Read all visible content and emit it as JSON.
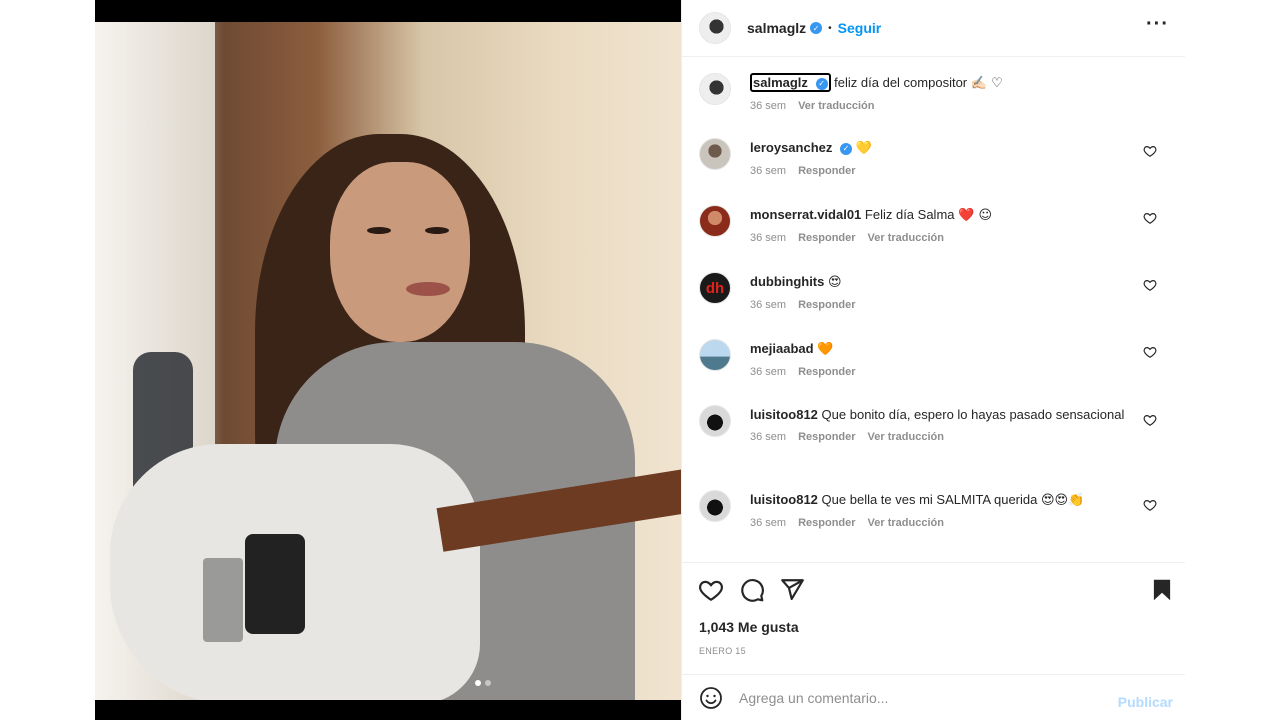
{
  "post": {
    "author": "salmaglz",
    "follow_label": "Seguir",
    "separator": "•",
    "more_label": "···",
    "next_label": "›"
  },
  "caption": {
    "user": "salmaglz",
    "text": "feliz día del compositor",
    "emoji": "✍🏻 ♡",
    "time": "36 sem",
    "translate": "Ver traducción"
  },
  "comments": [
    {
      "user": "leroysanchez",
      "verified": true,
      "text": "",
      "emoji": "💛",
      "time": "36 sem",
      "reply": "Responder",
      "translate": ""
    },
    {
      "user": "monserrat.vidal01",
      "verified": false,
      "text": "Feliz día Salma",
      "emoji": "❤️ ☺",
      "time": "36 sem",
      "reply": "Responder",
      "translate": "Ver traducción"
    },
    {
      "user": "dubbinghits",
      "verified": false,
      "text": "",
      "emoji": "😍",
      "time": "36 sem",
      "reply": "Responder",
      "translate": ""
    },
    {
      "user": "mejiaabad",
      "verified": false,
      "text": "",
      "emoji": "🧡",
      "time": "36 sem",
      "reply": "Responder",
      "translate": ""
    },
    {
      "user": "luisitoo812",
      "verified": false,
      "text": "Que bonito día, espero lo hayas pasado sensacional",
      "emoji": "",
      "time": "36 sem",
      "reply": "Responder",
      "translate": "Ver traducción"
    },
    {
      "user": "luisitoo812",
      "verified": false,
      "text": "Que bella te ves mi SALMITA querida",
      "emoji": "😍😍👏",
      "time": "36 sem",
      "reply": "Responder",
      "translate": "Ver traducción"
    }
  ],
  "avatars": {
    "dubbinghits": "dh"
  },
  "stats": {
    "likes": "1,043 Me gusta",
    "date": "ENERO 15"
  },
  "comment_box": {
    "placeholder": "Agrega un comentario...",
    "publish_label": "Publicar",
    "emoji_icon": "smiley-icon"
  },
  "colors": {
    "accent": "#0095f6",
    "verified": "#3897f0",
    "muted": "#8e8e8e",
    "publish_disabled": "#b3dbff",
    "dubbinghits_avatar": "#e2231a"
  }
}
